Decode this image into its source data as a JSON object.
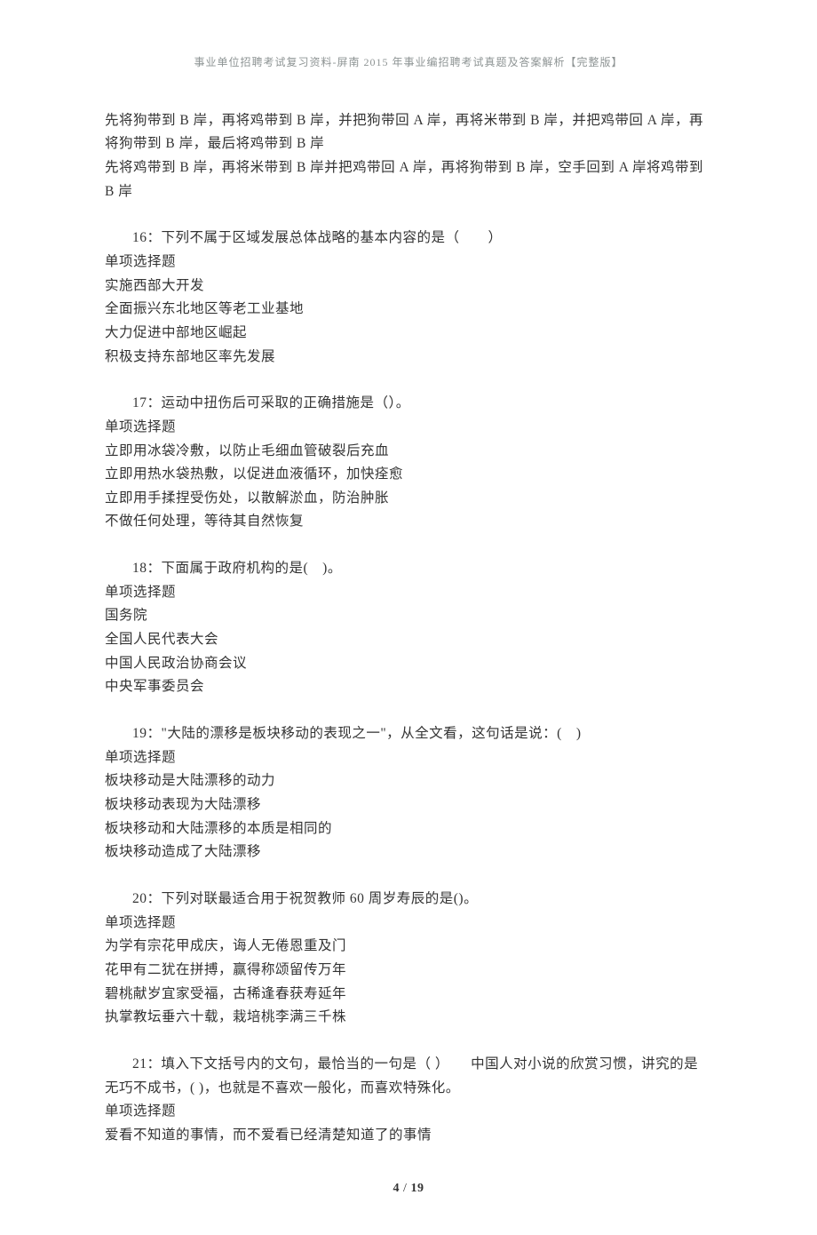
{
  "header": "事业单位招聘考试复习资料-屏南 2015 年事业编招聘考试真题及答案解析【完整版】",
  "preamble": {
    "p1": "先将狗带到 B 岸，再将鸡带到 B 岸，并把狗带回 A 岸，再将米带到 B 岸，并把鸡带回 A 岸，再将狗带到 B 岸，最后将鸡带到 B 岸",
    "p2": "先将鸡带到 B 岸，再将米带到 B 岸并把鸡带回 A 岸，再将狗带到 B 岸，空手回到 A 岸将鸡带到 B 岸"
  },
  "questions": [
    {
      "title": "16：下列不属于区域发展总体战略的基本内容的是（　　）",
      "type": "单项选择题",
      "options": [
        "实施西部大开发",
        "全面振兴东北地区等老工业基地",
        "大力促进中部地区崛起",
        "积极支持东部地区率先发展"
      ]
    },
    {
      "title": "17：运动中扭伤后可采取的正确措施是（）。",
      "type": "单项选择题",
      "options": [
        "立即用冰袋冷敷，以防止毛细血管破裂后充血",
        "立即用热水袋热敷，以促进血液循环，加快痊愈",
        "立即用手揉捏受伤处，以散解淤血，防治肿胀",
        "不做任何处理，等待其自然恢复"
      ]
    },
    {
      "title": "18：下面属于政府机构的是(　)。",
      "type": "单项选择题",
      "options": [
        "国务院",
        "全国人民代表大会",
        "中国人民政治协商会议",
        "中央军事委员会"
      ]
    },
    {
      "title": "19：\"大陆的漂移是板块移动的表现之一\"，从全文看，这句话是说：(　)",
      "type": "单项选择题",
      "options": [
        "板块移动是大陆漂移的动力",
        "板块移动表现为大陆漂移",
        "板块移动和大陆漂移的本质是相同的",
        "板块移动造成了大陆漂移"
      ]
    },
    {
      "title": "20：下列对联最适合用于祝贺教师 60 周岁寿辰的是()。",
      "type": "单项选择题",
      "options": [
        "为学有宗花甲成庆，诲人无倦恩重及门",
        "花甲有二犹在拼搏，赢得称颂留传万年",
        "碧桃献岁宜家受福，古稀逢春获寿延年",
        "执掌教坛垂六十载，栽培桃李满三千株"
      ]
    },
    {
      "title": "21：填入下文括号内的文句，最恰当的一句是（ ）　　中国人对小说的欣赏习惯，讲究的是无巧不成书，( )，也就是不喜欢一般化，而喜欢特殊化。",
      "type": "单项选择题",
      "options": [
        "爱看不知道的事情，而不爱看已经清楚知道了的事情"
      ]
    }
  ],
  "footer": {
    "page": "4",
    "sep": " / ",
    "total": "19"
  }
}
